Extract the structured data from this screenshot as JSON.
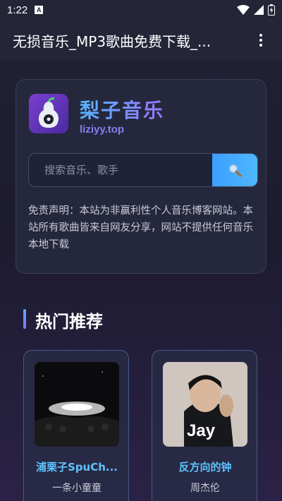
{
  "status_bar": {
    "time": "1:22",
    "notification_letter": "A"
  },
  "app_bar": {
    "title": "无损音乐_MP3歌曲免费下载_..."
  },
  "brand": {
    "name": "梨子音乐",
    "domain": "liziyy.top"
  },
  "search": {
    "placeholder": "搜索音乐、歌手"
  },
  "disclaimer": "免责声明：本站为非赢利性个人音乐博客网站。本站所有歌曲皆来自网友分享，网站不提供任何音乐本地下载",
  "section": {
    "title": "热门推荐"
  },
  "recommendations": [
    {
      "song": "浦栗子SpuCh...",
      "artist": "一条小童童"
    },
    {
      "song": "反方向的钟",
      "artist": "周杰伦",
      "cover_text": "Jay"
    }
  ],
  "colors": {
    "accent_blue": "#4fb6ff",
    "accent_purple": "#8a6cff",
    "song_title": "#5ec3ff"
  }
}
